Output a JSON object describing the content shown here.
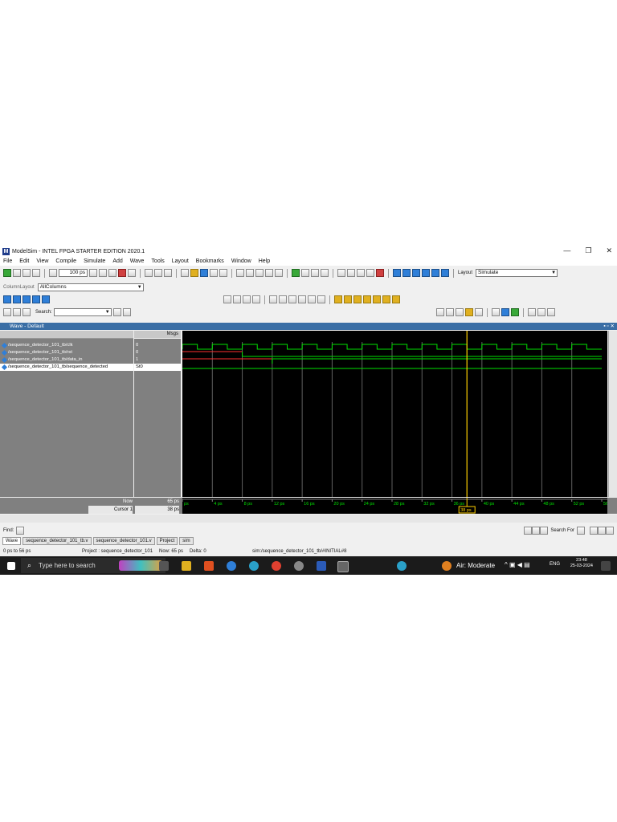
{
  "window": {
    "title": "ModelSim - INTEL FPGA STARTER EDITION 2020.1",
    "controls": [
      "—",
      "❐",
      "✕"
    ]
  },
  "menu": [
    "File",
    "Edit",
    "View",
    "Compile",
    "Simulate",
    "Add",
    "Wave",
    "Tools",
    "Layout",
    "Bookmarks",
    "Window",
    "Help"
  ],
  "toolbar": {
    "run_length": "100 ps",
    "layout_label": "Layout",
    "layout_value": "Simulate",
    "column_layout_label": "ColumnLayout",
    "column_layout_value": "AllColumns",
    "search_label": "Search:"
  },
  "wave_window": {
    "title": "Wave - Default",
    "msgs_header": "Msgs",
    "signals": [
      {
        "name": "/sequence_detector_101_tb/clk",
        "value": "0"
      },
      {
        "name": "/sequence_detector_101_tb/rst",
        "value": "0"
      },
      {
        "name": "/sequence_detector_101_tb/data_in",
        "value": "1"
      },
      {
        "name": "/sequence_detector_101_tb/sequence_detected",
        "value": "St0"
      }
    ],
    "now_label": "Now",
    "now_value": "65 ps",
    "cursor_label": "Cursor 1",
    "cursor_value": "38 ps",
    "cursor_flag": "38 ps",
    "time_ticks": [
      "ps",
      "4 ps",
      "8 ps",
      "12 ps",
      "16 ps",
      "20 ps",
      "24 ps",
      "28 ps",
      "32 ps",
      "36 ps",
      "40 ps",
      "44 ps",
      "48 ps",
      "52 ps",
      "56"
    ],
    "x_range_ps": [
      0,
      56
    ],
    "cursor_ps": 38,
    "clk_period_ps": 4,
    "colors": {
      "signal": "#00e000",
      "cursor": "#ffd000",
      "reset": "#ff3030"
    }
  },
  "find": {
    "label": "Find:",
    "search_for": "Search For"
  },
  "tabs": [
    "Wave",
    "sequence_detector_101_tb.v",
    "sequence_detector_101.v",
    "Project",
    "sim"
  ],
  "status": {
    "range": "0 ps to 56 ps",
    "project": "Project : sequence_detector_101",
    "now": "Now: 65 ps",
    "delta": "Delta: 0",
    "context": "sim:/sequence_detector_101_tb/#INITIAL#8"
  },
  "taskbar": {
    "search_placeholder": "Type here to search",
    "weather": "Air: Moderate",
    "lang": "ENG",
    "time": "23:48",
    "date": "25-03-2024"
  }
}
